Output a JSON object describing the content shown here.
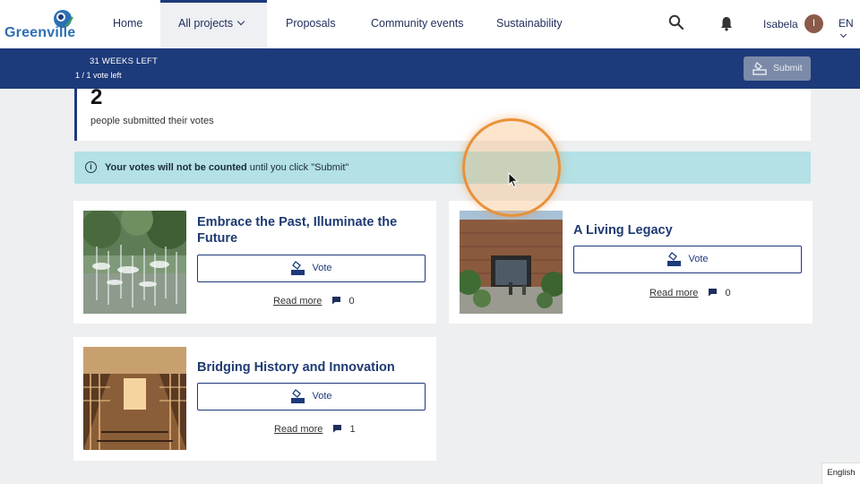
{
  "brand": {
    "name": "Greenville"
  },
  "nav": {
    "items": [
      {
        "label": "Home"
      },
      {
        "label": "All projects"
      },
      {
        "label": "Proposals"
      },
      {
        "label": "Community events"
      },
      {
        "label": "Sustainability"
      }
    ],
    "user_name": "Isabela",
    "avatar_initial": "I",
    "language": "EN"
  },
  "voting_bar": {
    "time_left": "31 WEEKS LEFT",
    "votes_left": "1 / 1 vote left",
    "submit_label": "Submit"
  },
  "stats": {
    "count": "2",
    "label": "people submitted their votes"
  },
  "notice": {
    "bold": "Your votes will not be counted",
    "rest": " until you click \"Submit\""
  },
  "projects": [
    {
      "title": "Embrace the Past, Illuminate the Future",
      "vote_label": "Vote",
      "read_more": "Read more",
      "comments": "0"
    },
    {
      "title": "A Living Legacy",
      "vote_label": "Vote",
      "read_more": "Read more",
      "comments": "0"
    },
    {
      "title": "Bridging History and Innovation",
      "vote_label": "Vote",
      "read_more": "Read more",
      "comments": "1"
    }
  ],
  "footer_language": "English",
  "colors": {
    "primary": "#1d3a7a",
    "title": "#1f3a72",
    "notice_bg": "#b3e1e5",
    "brand_blue": "#2c6fb3",
    "cursor_ring": "#e8913b"
  }
}
